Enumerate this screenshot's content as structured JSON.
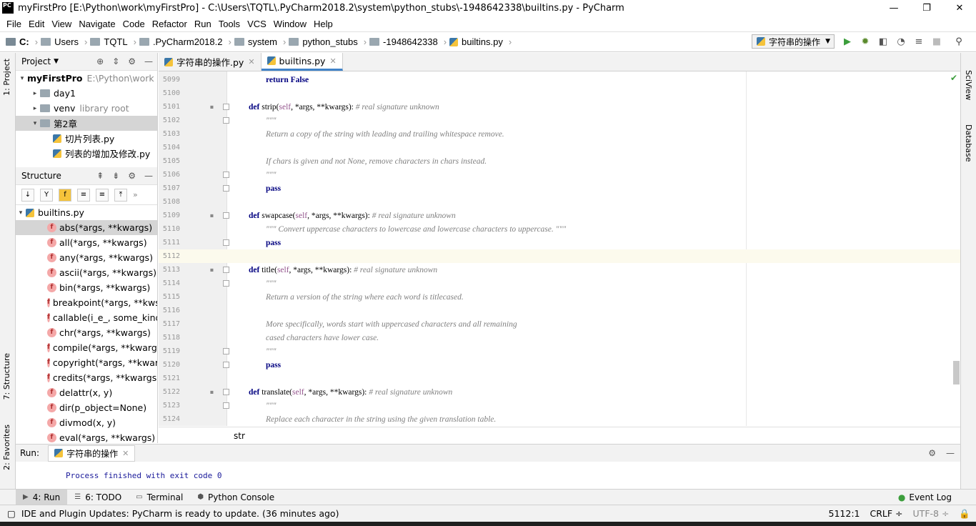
{
  "window": {
    "title": "myFirstPro [E:\\Python\\work\\myFirstPro] - C:\\Users\\TQTL\\.PyCharm2018.2\\system\\python_stubs\\-1948642338\\builtins.py - PyCharm",
    "minimize": "—",
    "restore": "❐",
    "close": "✕"
  },
  "menu": [
    "File",
    "Edit",
    "View",
    "Navigate",
    "Code",
    "Refactor",
    "Run",
    "Tools",
    "VCS",
    "Window",
    "Help"
  ],
  "breadcrumbs": [
    "C:",
    "Users",
    "TQTL",
    ".PyCharm2018.2",
    "system",
    "python_stubs",
    "-1948642338",
    "builtins.py"
  ],
  "run_config": "字符串的操作",
  "project_panel": {
    "title": "Project",
    "items": [
      {
        "label": "myFirstPro",
        "extra": "E:\\Python\\work",
        "level": 0,
        "arrow": "▾",
        "bold": true
      },
      {
        "label": "day1",
        "extra": "",
        "level": 1,
        "arrow": "▸"
      },
      {
        "label": "venv",
        "extra": "library root",
        "level": 1,
        "arrow": "▸"
      },
      {
        "label": "第2章",
        "extra": "",
        "level": 1,
        "arrow": "▾",
        "selected": true
      },
      {
        "label": "切片列表.py",
        "extra": "",
        "level": 2,
        "arrow": ""
      },
      {
        "label": "列表的增加及修改.py",
        "extra": "",
        "level": 2,
        "arrow": ""
      }
    ]
  },
  "structure_panel": {
    "title": "Structure",
    "root": "builtins.py",
    "items": [
      "abs(*args, **kwargs)",
      "all(*args, **kwargs)",
      "any(*args, **kwargs)",
      "ascii(*args, **kwargs)",
      "bin(*args, **kwargs)",
      "breakpoint(*args, **kws)",
      "callable(i_e_, some_kind_",
      "chr(*args, **kwargs)",
      "compile(*args, **kwargs)",
      "copyright(*args, **kwargs)",
      "credits(*args, **kwargs)",
      "delattr(x, y)",
      "dir(p_object=None)",
      "divmod(x, y)",
      "eval(*args, **kwargs)"
    ]
  },
  "editor_tabs": [
    {
      "label": "字符串的操作.py",
      "active": false
    },
    {
      "label": "builtins.py",
      "active": true
    }
  ],
  "code_lines": [
    {
      "n": "5099",
      "html": "<span class='kw'>return False</span>",
      "indent": 2
    },
    {
      "n": "5100",
      "html": "",
      "indent": 0
    },
    {
      "n": "5101",
      "html": "<span class='kw'>def</span> strip(<span class='sf'>self</span>, *args, **kwargs): <span class='cm'># real signature unknown</span>",
      "indent": 1,
      "marker": true
    },
    {
      "n": "5102",
      "html": "<span class='cm'>\"\"\"</span>",
      "indent": 2
    },
    {
      "n": "5103",
      "html": "<span class='cm'>Return a copy of the string with leading and trailing whitespace remove.</span>",
      "indent": 2
    },
    {
      "n": "5104",
      "html": "",
      "indent": 0
    },
    {
      "n": "5105",
      "html": "<span class='cm'>If chars is given and not None, remove characters in chars instead.</span>",
      "indent": 2
    },
    {
      "n": "5106",
      "html": "<span class='cm'>\"\"\"</span>",
      "indent": 2
    },
    {
      "n": "5107",
      "html": "<span class='kw'>pass</span>",
      "indent": 2
    },
    {
      "n": "5108",
      "html": "",
      "indent": 0
    },
    {
      "n": "5109",
      "html": "<span class='kw'>def</span> swapcase(<span class='sf'>self</span>, *args, **kwargs): <span class='cm'># real signature unknown</span>",
      "indent": 1,
      "marker": true
    },
    {
      "n": "5110",
      "html": "<span class='cm'>\"\"\" Convert uppercase characters to lowercase and lowercase characters to uppercase. \"\"\"</span>",
      "indent": 2
    },
    {
      "n": "5111",
      "html": "<span class='kw'>pass</span>",
      "indent": 2
    },
    {
      "n": "5112",
      "html": "",
      "indent": 0,
      "current": true
    },
    {
      "n": "5113",
      "html": "<span class='kw'>def</span> title(<span class='sf'>self</span>, *args, **kwargs): <span class='cm'># real signature unknown</span>",
      "indent": 1,
      "marker": true
    },
    {
      "n": "5114",
      "html": "<span class='cm'>\"\"\"</span>",
      "indent": 2
    },
    {
      "n": "5115",
      "html": "<span class='cm'>Return a version of the string where each word is titlecased.</span>",
      "indent": 2
    },
    {
      "n": "5116",
      "html": "",
      "indent": 0
    },
    {
      "n": "5117",
      "html": "<span class='cm'>More specifically, words start with uppercased characters and all remaining</span>",
      "indent": 2
    },
    {
      "n": "5118",
      "html": "<span class='cm'>cased characters have lower case.</span>",
      "indent": 2
    },
    {
      "n": "5119",
      "html": "<span class='cm'>\"\"\"</span>",
      "indent": 2
    },
    {
      "n": "5120",
      "html": "<span class='kw'>pass</span>",
      "indent": 2
    },
    {
      "n": "5121",
      "html": "",
      "indent": 0
    },
    {
      "n": "5122",
      "html": "<span class='kw'>def</span> translate(<span class='sf'>self</span>, *args, **kwargs): <span class='cm'># real signature unknown</span>",
      "indent": 1,
      "marker": true
    },
    {
      "n": "5123",
      "html": "<span class='cm'>\"\"\"</span>",
      "indent": 2
    },
    {
      "n": "5124",
      "html": "<span class='cm'>Replace each character in the string using the given translation table.</span>",
      "indent": 2
    }
  ],
  "editor_breadcrumb": "str",
  "run_panel": {
    "label": "Run:",
    "tab": "字符串的操作",
    "output": "Process finished with exit code 0"
  },
  "bottom_tabs": [
    "4: Run",
    "6: TODO",
    "Terminal",
    "Python Console"
  ],
  "event_log": "Event Log",
  "status": {
    "message": "IDE and Plugin Updates: PyCharm is ready to update. (36 minutes ago)",
    "position": "5112:1",
    "line_sep": "CRLF ÷",
    "encoding": "UTF-8 ÷"
  },
  "side_labels": {
    "project": "1: Project",
    "structure": "7: Structure",
    "favorites": "2: Favorites",
    "sciview": "SciView",
    "database": "Database"
  },
  "colors": {
    "accent": "#4083c9",
    "keyword": "#000080",
    "comment": "#808080",
    "self": "#94558d",
    "run_green": "#3c9e3c"
  }
}
